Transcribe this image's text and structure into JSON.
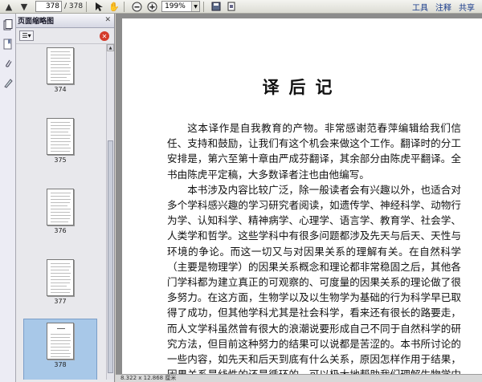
{
  "toolbar": {
    "current_page": "378",
    "page_total": "/ 378",
    "zoom": "199%",
    "menu": {
      "tools": "工具",
      "comment": "注释",
      "share": "共享"
    }
  },
  "panel": {
    "title": "页面缩略图",
    "thumbnails": [
      {
        "label": "374"
      },
      {
        "label": "375"
      },
      {
        "label": "376"
      },
      {
        "label": "377"
      },
      {
        "label": "378"
      }
    ]
  },
  "document": {
    "title": "译后记",
    "paragraphs": [
      "这本译作是自我教育的产物。非常感谢范春萍编辑给我们信任、支持和鼓励，让我们有这个机会来做这个工作。翻译时的分工安排是，第六至第十章由严成芬翻译，其余部分由陈虎平翻译。全书由陈虎平定稿，大多数译者注也由他编写。",
      "本书涉及内容比较广泛，除一般读者会有兴趣以外，也适合对多个学科感兴趣的学习研究者阅读，如遗传学、神经科学、动物行为学、认知科学、精神病学、心理学、语言学、教育学、社会学、人类学和哲学。这些学科中有很多问题都涉及先天与后天、天性与环境的争论。而这一切又与对因果关系的理解有关。在自然科学（主要是物理学）的因果关系概念和理论都非常稳固之后，其他各门学科都为建立真正的可观察的、可度量的因果关系的理论做了很多努力。在这方面，生物学以及以生物学为基础的行为科学早已取得了成功，但其他学科尤其是社会科学，看来还有很长的路要走，而人文学科虽然曾有很大的浪潮说要形成自己不同于自然科学的研究方法，但目前这种努力的结果可以说都是苦涩的。本书所讨论的一些内容，如先天和后天到底有什么关系，原因怎样作用于结果，因果关系是线性的还是循环的，可以极大地帮助我们理解生物学中的因果关系，廓清流行的很多错误认"
    ]
  },
  "status": {
    "page_size": "8.322 x 12.868 厘米"
  }
}
